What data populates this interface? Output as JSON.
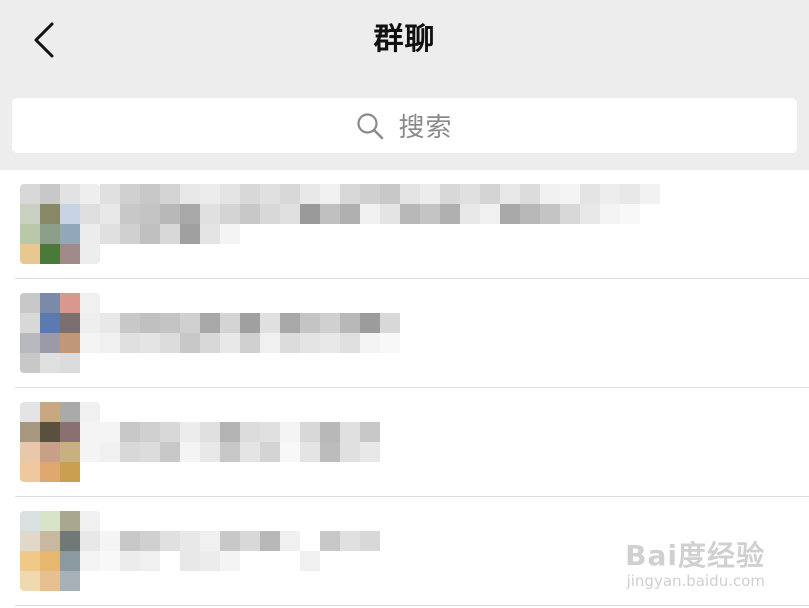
{
  "nav": {
    "title": "群聊",
    "back_icon": "chevron-left-icon"
  },
  "search": {
    "placeholder": "搜索",
    "icon": "search-icon"
  },
  "groups": [
    {
      "name_obscured": true,
      "avatar_colors": [
        "#d8d8d8",
        "#c8c8c8",
        "#e2e2e2",
        "#eeeeee",
        "#c8d0c2",
        "#888866",
        "#c8d4e4",
        "#dedede",
        "#b8c8a8",
        "#8c9e8a",
        "#90a8b8",
        "#ececec",
        "#e8c890",
        "#4a7a3a",
        "#a08a8a",
        "#ededed"
      ],
      "name_rows": [
        [
          "#e0e0e0",
          "#d0d0d0",
          "#c8c8c8",
          "#d4d4d4",
          "#e8e8e8",
          "#ececec",
          "#e4e4e4",
          "#d8d8d8",
          "#e0e0e0",
          "#d8d8d8",
          "#e8e8e8",
          "#f0f0f0",
          "#d8d8d8",
          "#d0d0d0",
          "#c8c8c8",
          "#e4e4e4",
          "#ececec",
          "#d8d8d8",
          "#e0e0e0",
          "#d4d4d4",
          "#e8e8e8",
          "#dcdcdc",
          "#f0f0f0",
          "#f4f4f4",
          "#e4e4e4",
          "#ededed",
          "#e8e8e8",
          "#f2f2f2",
          "#ffffff",
          "#ffffff"
        ],
        [
          "#e8e8e8",
          "#c8c8c8",
          "#c4c4c4",
          "#b8b8b8",
          "#a8a8a8",
          "#e0e0e0",
          "#d4d4d4",
          "#c8c8c8",
          "#d8d8d8",
          "#e0e0e0",
          "#9a9a9a",
          "#c0c0c0",
          "#b0b0b0",
          "#f0f0f0",
          "#e4e4e4",
          "#b8b8b8",
          "#c4c4c4",
          "#b0b0b0",
          "#e8e8e8",
          "#f0f0f0",
          "#a8a8a8",
          "#b8b8b8",
          "#c4c4c4",
          "#d8d8d8",
          "#e8e8e8",
          "#f4f4f4",
          "#f8f8f8",
          "#ffffff",
          "#ffffff",
          "#ffffff"
        ],
        [
          "#e0e0e0",
          "#d0d0d0",
          "#c0c0c0",
          "#d8d8d8",
          "#a0a0a0",
          "#e4e4e4",
          "#f4f4f4",
          "#ffffff",
          "#ffffff",
          "#ffffff",
          "#ffffff",
          "#ffffff",
          "#ffffff",
          "#ffffff",
          "#ffffff",
          "#ffffff",
          "#ffffff",
          "#ffffff",
          "#ffffff",
          "#ffffff",
          "#ffffff",
          "#ffffff",
          "#ffffff",
          "#ffffff",
          "#ffffff",
          "#ffffff",
          "#ffffff",
          "#ffffff",
          "#ffffff",
          "#ffffff"
        ]
      ]
    },
    {
      "name_obscured": true,
      "avatar_colors": [
        "#c8c8c8",
        "#7a8aa8",
        "#d89890",
        "#f0f0f0",
        "#d8d8d8",
        "#5a7ab0",
        "#7a7070",
        "#eeeeee",
        "#b8b8c0",
        "#9a9aa8",
        "#c09878",
        "#f4f4f4",
        "#c8c8c8",
        "#e0e0e0",
        "#dcdcdc",
        "#ffffff"
      ],
      "name_rows": [
        [
          "#ffffff",
          "#ffffff",
          "#ffffff",
          "#ffffff",
          "#ffffff",
          "#ffffff",
          "#ffffff",
          "#ffffff",
          "#ffffff",
          "#ffffff",
          "#ffffff",
          "#ffffff",
          "#ffffff",
          "#ffffff",
          "#ffffff",
          "#ffffff"
        ],
        [
          "#e8e8e8",
          "#c8c8c8",
          "#c0c0c0",
          "#c4c4c4",
          "#d0d0d0",
          "#a8a8a8",
          "#d4d4d4",
          "#a0a0a0",
          "#e0e0e0",
          "#a8a8a8",
          "#c4c4c4",
          "#d0d0d0",
          "#b8b8b8",
          "#9c9c9c",
          "#d8d8d8",
          "#ffffff"
        ],
        [
          "#f0f0f0",
          "#e0e0e0",
          "#e4e4e4",
          "#dcdcdc",
          "#c8c8c8",
          "#d8d8d8",
          "#e8e8e8",
          "#d0d0d0",
          "#f0f0f0",
          "#dcdcdc",
          "#e4e4e4",
          "#e8e8e8",
          "#e0e0e0",
          "#f4f4f4",
          "#f8f8f8",
          "#ffffff"
        ]
      ]
    },
    {
      "name_obscured": true,
      "avatar_colors": [
        "#e4e4e4",
        "#c8a880",
        "#aaaaaa",
        "#f0f0f0",
        "#a89880",
        "#5a5040",
        "#8a7070",
        "#f4f4f4",
        "#e8c8a8",
        "#c8a088",
        "#c8b080",
        "#f4f4f4",
        "#f0c8a0",
        "#e0a870",
        "#c8a050",
        "#ffffff"
      ],
      "name_rows": [
        [
          "#ffffff",
          "#ffffff",
          "#ffffff",
          "#ffffff",
          "#ffffff",
          "#ffffff",
          "#ffffff",
          "#ffffff",
          "#ffffff",
          "#ffffff",
          "#ffffff",
          "#ffffff",
          "#ffffff",
          "#ffffff",
          "#ffffff"
        ],
        [
          "#f4f4f4",
          "#c8c8c8",
          "#d0d0d0",
          "#d8d8d8",
          "#ececec",
          "#e0e0e0",
          "#b4b4b4",
          "#dcdcdc",
          "#e0e0e0",
          "#f4f4f4",
          "#d8d8d8",
          "#b8b8b8",
          "#e0e0e0",
          "#c8c8c8",
          "#ffffff"
        ],
        [
          "#f0f0f0",
          "#d8d8d8",
          "#dcdcdc",
          "#c8c8c8",
          "#f4f4f4",
          "#e8e8e8",
          "#c8c8c8",
          "#e4e4e4",
          "#d4d4d4",
          "#f8f8f8",
          "#e4e4e4",
          "#bcbcbc",
          "#e0e0e0",
          "#e8e8e8",
          "#ffffff"
        ]
      ]
    },
    {
      "name_obscured": true,
      "avatar_colors": [
        "#d8e0e0",
        "#d8e4c8",
        "#a8a890",
        "#f0f0f0",
        "#e0d8c8",
        "#c8b8a0",
        "#707878",
        "#e8e8e8",
        "#f0c888",
        "#e8b870",
        "#8a9aa0",
        "#f4f4f4",
        "#f0d8b0",
        "#e8c090",
        "#a8b0b8",
        "#ffffff"
      ],
      "name_rows": [
        [
          "#ffffff",
          "#ffffff",
          "#ffffff",
          "#ffffff",
          "#ffffff",
          "#ffffff",
          "#ffffff",
          "#ffffff",
          "#ffffff",
          "#ffffff",
          "#ffffff",
          "#ffffff",
          "#ffffff",
          "#ffffff",
          "#ffffff"
        ],
        [
          "#f4f4f4",
          "#c8c8c8",
          "#d0d0d0",
          "#e0e0e0",
          "#e8e8e8",
          "#f0f0f0",
          "#c8c8c8",
          "#d8d8d8",
          "#b8b8b8",
          "#f0f0f0",
          "#ffffff",
          "#c8c8c8",
          "#e0e0e0",
          "#d8d8d8",
          "#ffffff"
        ],
        [
          "#f8f8f8",
          "#ececec",
          "#f0f0f0",
          "#ffffff",
          "#e8e8e8",
          "#ececec",
          "#f4f4f4",
          "#ffffff",
          "#ffffff",
          "#ffffff",
          "#f0f0f0",
          "#ffffff",
          "#ffffff",
          "#ffffff",
          "#ffffff"
        ]
      ]
    }
  ],
  "watermark": {
    "logo": "Bai度经验",
    "url": "jingyan.baidu.com"
  }
}
